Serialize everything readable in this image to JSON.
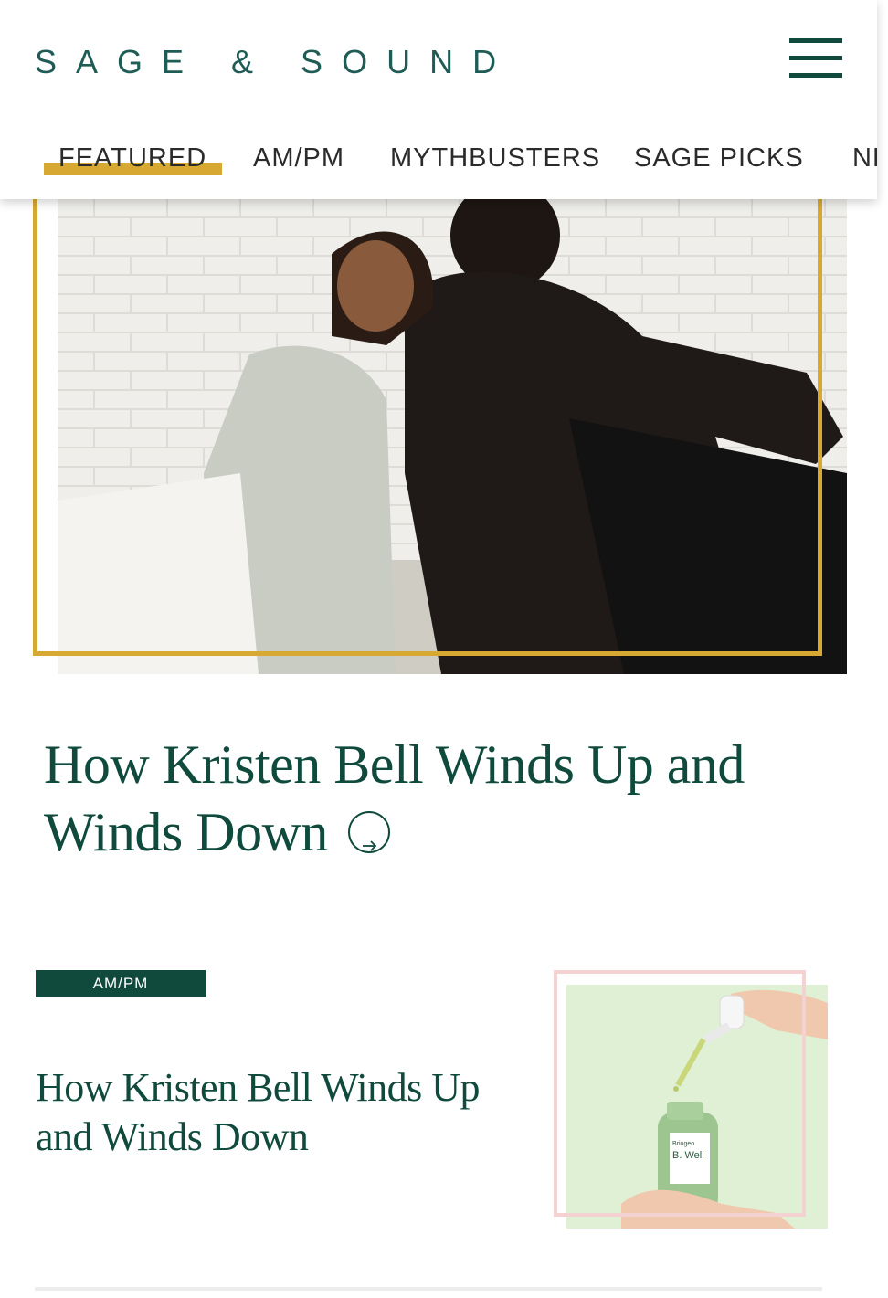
{
  "header": {
    "logo": "SAGE & SOUND",
    "nav": [
      "FEATURED",
      "AM/PM",
      "MYTHBUSTERS",
      "SAGE PICKS",
      "NE"
    ]
  },
  "hero": {
    "title": "How Kristen Bell Winds Up and Winds Down",
    "frame_color": "#d7a832"
  },
  "card": {
    "badge": "AM/PM",
    "title": "How Kristen Bell Winds Up and Winds Down",
    "bottle_brand": "Briogeo",
    "bottle_product": "B. Well",
    "frame_color": "#f5d2d2"
  },
  "colors": {
    "brand": "#0f4a3c",
    "accent": "#d7a832"
  },
  "icons": [
    "menu-icon",
    "arrow-right-icon"
  ]
}
